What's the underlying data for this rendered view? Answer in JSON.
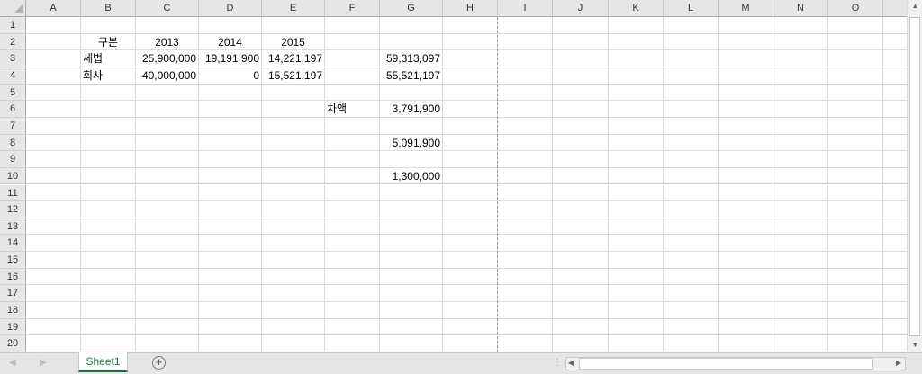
{
  "columns": [
    "A",
    "B",
    "C",
    "D",
    "E",
    "F",
    "G",
    "H",
    "I",
    "J",
    "K",
    "L",
    "M",
    "N",
    "O"
  ],
  "row_count": 20,
  "cells": {
    "B2": {
      "v": "구분",
      "a": "c"
    },
    "C2": {
      "v": "2013",
      "a": "c"
    },
    "D2": {
      "v": "2014",
      "a": "c"
    },
    "E2": {
      "v": "2015",
      "a": "c"
    },
    "B3": {
      "v": "세법",
      "a": "l"
    },
    "C3": {
      "v": "25,900,000",
      "a": "r"
    },
    "D3": {
      "v": "19,191,900",
      "a": "r"
    },
    "E3": {
      "v": "14,221,197",
      "a": "r"
    },
    "G3": {
      "v": "59,313,097",
      "a": "r"
    },
    "B4": {
      "v": "회사",
      "a": "l"
    },
    "C4": {
      "v": "40,000,000",
      "a": "r"
    },
    "D4": {
      "v": "0",
      "a": "r"
    },
    "E4": {
      "v": "15,521,197",
      "a": "r"
    },
    "G4": {
      "v": "55,521,197",
      "a": "r"
    },
    "F6": {
      "v": "차액",
      "a": "l"
    },
    "G6": {
      "v": "3,791,900",
      "a": "r"
    },
    "G8": {
      "v": "5,091,900",
      "a": "r"
    },
    "G10": {
      "v": "1,300,000",
      "a": "r"
    }
  },
  "sheet_tabs": {
    "active": "Sheet1",
    "add_label": "+"
  },
  "colors": {
    "accent": "#217346"
  }
}
